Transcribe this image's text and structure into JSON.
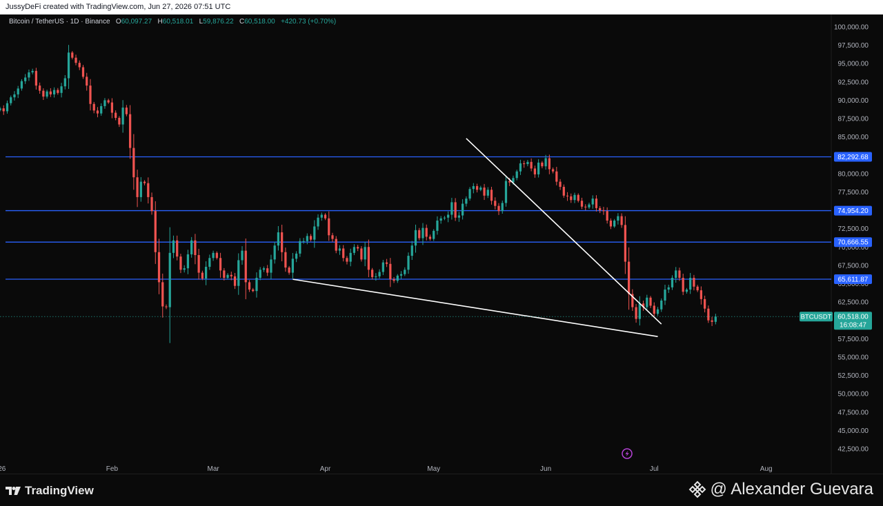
{
  "header": {
    "credit": "JussyDeFi created with TradingView.com, Jun 27, 2026 07:51 UTC"
  },
  "legend": {
    "symbol": "Bitcoin / TetherUS · 1D · Binance",
    "open_label": "O",
    "open": "60,097.27",
    "high_label": "H",
    "high": "60,518.01",
    "low_label": "L",
    "low": "59,876.22",
    "close_label": "C",
    "close": "60,518.00",
    "change": "+420.73 (+0.70%)"
  },
  "colors": {
    "up": "#26a69a",
    "down": "#ef5350",
    "level": "#2962ff",
    "trendline": "#ffffff",
    "price_tag": "#26a69a"
  },
  "footer": {
    "brand": "TradingView",
    "watermark": "@ Alexander Guevara",
    "watermark_icon": "binance-diamond-icon"
  },
  "chart_data": {
    "type": "candlestick",
    "title": "Bitcoin / TetherUS · 1D · Binance",
    "y_range": [
      40000,
      102000
    ],
    "x_range": [
      "2026-01-01",
      "2026-08-19"
    ],
    "y_ticks": [
      "100,000.00",
      "97,500.00",
      "95,000.00",
      "92,500.00",
      "90,000.00",
      "87,500.00",
      "85,000.00",
      "80,000.00",
      "77,500.00",
      "72,500.00",
      "70,000.00",
      "67,500.00",
      "65,000.00",
      "62,500.00",
      "57,500.00",
      "55,000.00",
      "52,500.00",
      "50,000.00",
      "47,500.00",
      "45,000.00",
      "42,500.00"
    ],
    "x_ticks": [
      {
        "date": "2026-01-01",
        "label": "026"
      },
      {
        "date": "2026-02-01",
        "label": "Feb"
      },
      {
        "date": "2026-03-01",
        "label": "Mar"
      },
      {
        "date": "2026-04-01",
        "label": "Apr"
      },
      {
        "date": "2026-05-01",
        "label": "May"
      },
      {
        "date": "2026-06-01",
        "label": "Jun"
      },
      {
        "date": "2026-07-01",
        "label": "Jul"
      },
      {
        "date": "2026-08-01",
        "label": "Aug"
      }
    ],
    "levels": [
      {
        "value": 82292.68,
        "label": "82,292.68"
      },
      {
        "value": 74954.2,
        "label": "74,954.20"
      },
      {
        "value": 70666.55,
        "label": "70,666.55"
      },
      {
        "value": 65611.87,
        "label": "65,611.87"
      }
    ],
    "trendlines": [
      {
        "from": [
          "2026-05-10",
          84800
        ],
        "to": [
          "2026-07-03",
          59500
        ]
      },
      {
        "from": [
          "2026-03-23",
          65600
        ],
        "to": [
          "2026-07-02",
          57800
        ]
      }
    ],
    "current_price": {
      "symbol": "BTCUSDT",
      "value": 60518.0,
      "label": "60,518.00",
      "countdown": "16:08:47"
    },
    "close_series": {
      "start": "2026-01-01",
      "closes": [
        88900,
        88500,
        89600,
        90400,
        90800,
        91600,
        92600,
        93100,
        93800,
        94000,
        92000,
        91300,
        90500,
        91200,
        90800,
        91400,
        91000,
        91900,
        93000,
        96500,
        95800,
        95100,
        94500,
        93200,
        92000,
        89500,
        88600,
        88200,
        89200,
        90000,
        89700,
        88300,
        87600,
        86700,
        89000,
        88100,
        83500,
        79500,
        76800,
        78900,
        78700,
        76800,
        74900,
        69300,
        65200,
        61900,
        61800,
        69200,
        70900,
        68700,
        66900,
        67100,
        69000,
        70900,
        68900,
        66500,
        65700,
        67300,
        68500,
        69200,
        68500,
        66800,
        65800,
        66200,
        66000,
        64700,
        68200,
        69500,
        65200,
        64200,
        64000,
        65800,
        66900,
        67100,
        66500,
        68300,
        70200,
        72000,
        69300,
        67200,
        66500,
        68400,
        69100,
        70800,
        70800,
        71500,
        71000,
        72800,
        74000,
        74400,
        73900,
        71600,
        71100,
        69500,
        69800,
        68500,
        68000,
        69200,
        70000,
        69800,
        68300,
        70000,
        66900,
        65900,
        66000,
        66600,
        67900,
        67700,
        65600,
        65400,
        66100,
        66300,
        66900,
        68800,
        70200,
        72300,
        71200,
        72600,
        71400,
        71100,
        72200,
        73600,
        73900,
        74000,
        74400,
        76100,
        74000,
        74300,
        75900,
        76600,
        77900,
        78300,
        77800,
        78100,
        77000,
        77800,
        76300,
        75600,
        74900,
        76000,
        79000,
        78800,
        79400,
        80300,
        81400,
        81300,
        81600,
        80700,
        79900,
        81500,
        81000,
        82100,
        80600,
        80300,
        78900,
        78200,
        77000,
        76900,
        76400,
        77100,
        76300,
        75500,
        75400,
        75800,
        76600,
        75300,
        75000,
        74900,
        73600,
        72800,
        73600,
        74200,
        73000,
        68000,
        63600,
        61800,
        60200,
        62300,
        61800,
        63100,
        62000,
        60900,
        61500,
        62700,
        64200,
        64500,
        65800,
        66800,
        65800,
        63900,
        64200,
        65800,
        64600,
        64100,
        62900,
        61600,
        60000,
        59800,
        60518
      ]
    }
  }
}
